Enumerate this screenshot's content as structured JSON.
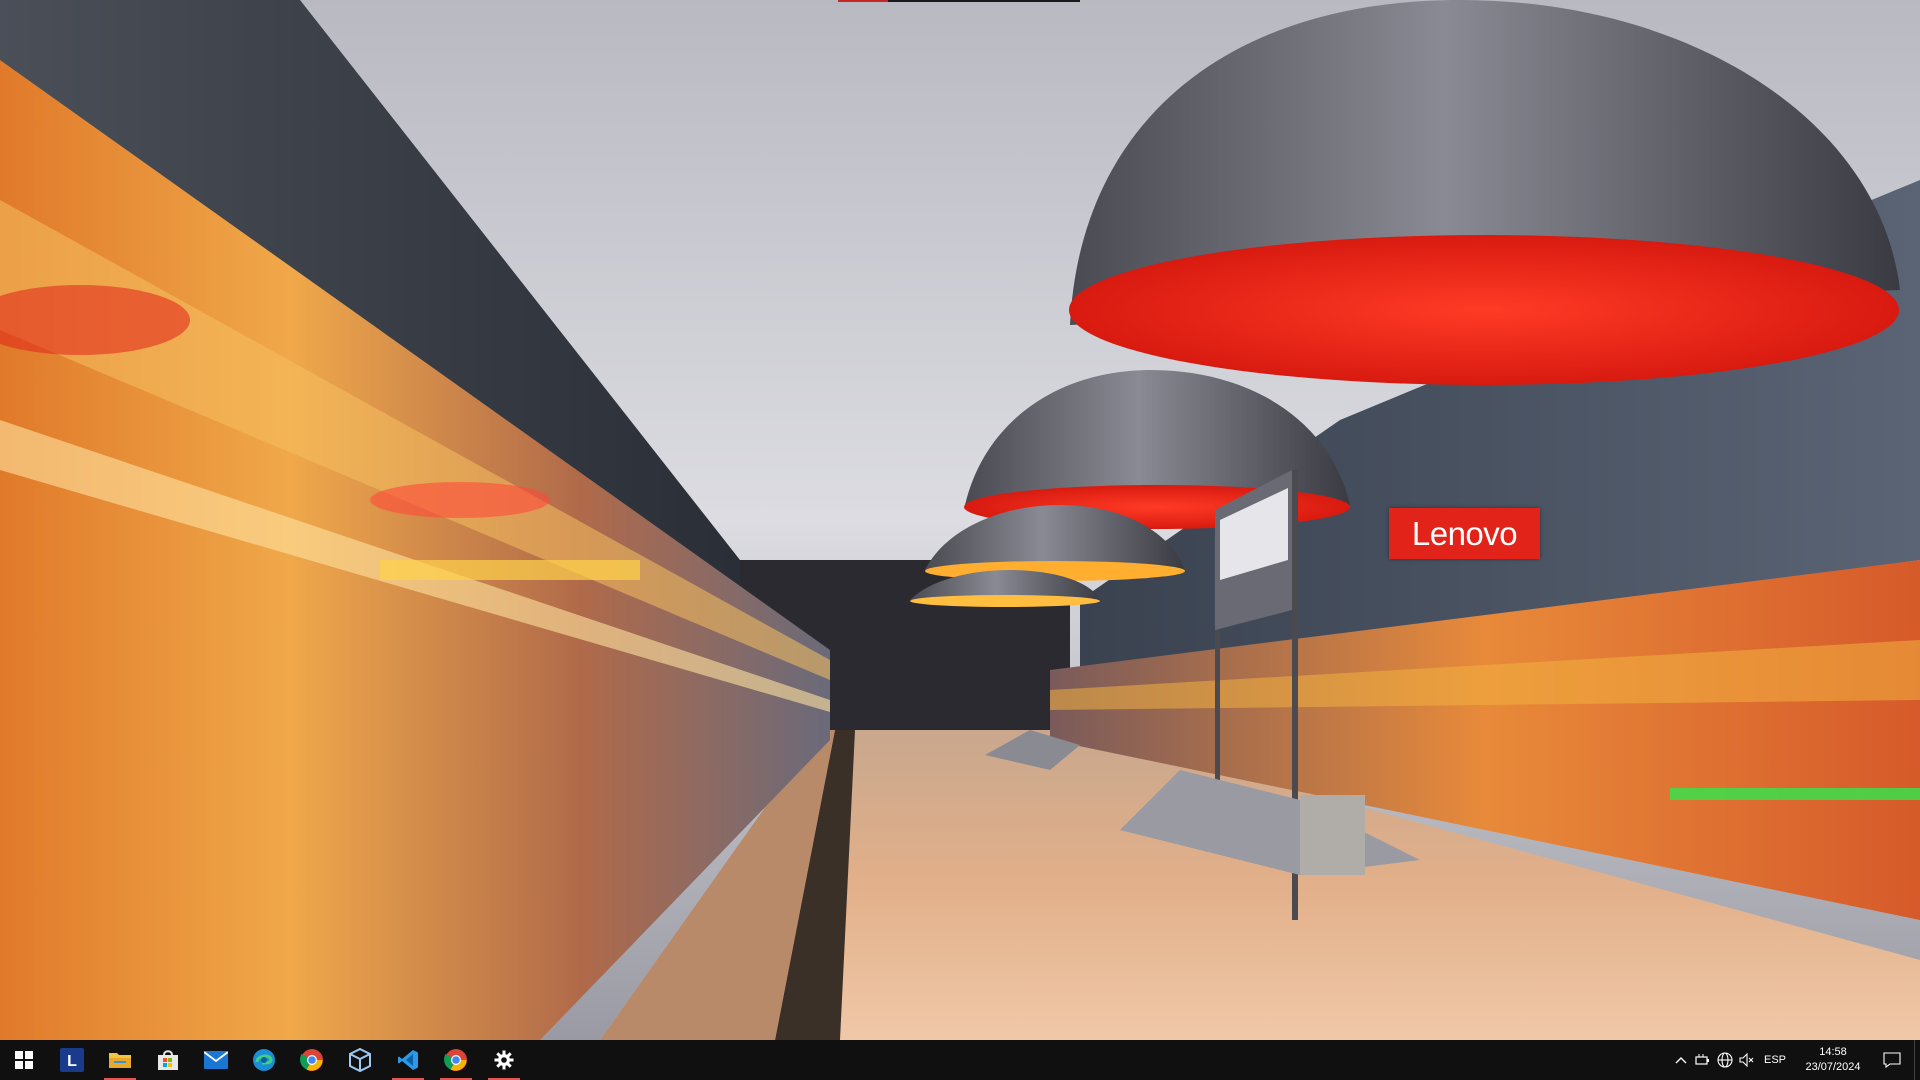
{
  "wallpaper": {
    "brand": "Lenovo",
    "scene": "subway-station",
    "colors": {
      "lamp_red": "#e8241b",
      "ceiling": "#c9c9cf",
      "wall": "#4a5260",
      "floor": "#d9a57a",
      "train_blur": "#f2a13a"
    }
  },
  "taskbar": {
    "background": "#101010",
    "accent": "#e0584b",
    "apps": [
      {
        "name": "start",
        "icon": "windows-logo-icon"
      },
      {
        "name": "lenovo-vantage",
        "icon": "lenovo-l-icon"
      },
      {
        "name": "file-explorer",
        "icon": "folder-icon"
      },
      {
        "name": "microsoft-store",
        "icon": "store-bag-icon"
      },
      {
        "name": "mail",
        "icon": "mail-icon"
      },
      {
        "name": "edge",
        "icon": "edge-icon"
      },
      {
        "name": "chrome",
        "icon": "chrome-icon"
      },
      {
        "name": "virtualbox",
        "icon": "cube-icon"
      },
      {
        "name": "vscode",
        "icon": "vscode-icon"
      },
      {
        "name": "chrome-2",
        "icon": "chrome-icon"
      },
      {
        "name": "settings",
        "icon": "gear-icon"
      }
    ],
    "tray": {
      "language": "ESP",
      "time": "14:58",
      "date": "23/07/2024"
    }
  }
}
